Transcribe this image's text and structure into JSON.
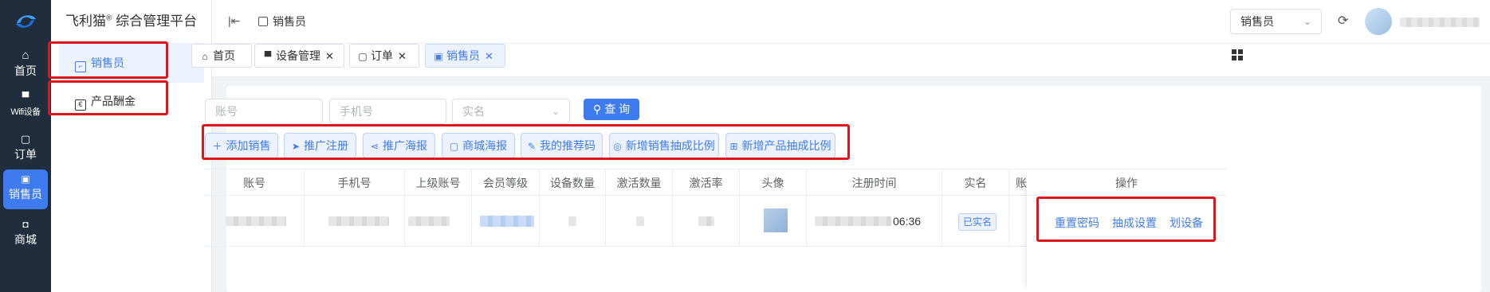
{
  "rail": {
    "items": [
      {
        "label": "首页",
        "icon": "home-icon"
      },
      {
        "label": "Wifi设备",
        "icon": "monitor-icon"
      },
      {
        "label": "订单",
        "icon": "clipboard-icon"
      },
      {
        "label": "销售员",
        "icon": "badge-icon"
      },
      {
        "label": "商城",
        "icon": "shop-icon"
      }
    ],
    "active_index": 3,
    "accent": "#3e7bf0",
    "background": "#1f2d3d"
  },
  "brand": {
    "name": "飞利猫",
    "mark": "®",
    "suffix": " 综合管理平台"
  },
  "sidebar": {
    "items": [
      {
        "label": "销售员",
        "icon": "badge-icon"
      },
      {
        "label": "产品酬金",
        "icon": "currency-icon"
      }
    ],
    "active_index": 0
  },
  "header": {
    "breadcrumb": "销售员",
    "role_select": {
      "value": "销售员"
    }
  },
  "tabs": [
    {
      "label": "首页",
      "icon": "home-icon",
      "closable": false
    },
    {
      "label": "设备管理",
      "icon": "monitor-icon",
      "closable": true
    },
    {
      "label": "订单",
      "icon": "clipboard-icon",
      "closable": true
    },
    {
      "label": "销售员",
      "icon": "badge-icon",
      "closable": true,
      "active": true
    }
  ],
  "filters": {
    "account_placeholder": "账号",
    "phone_placeholder": "手机号",
    "realname_placeholder": "实名",
    "query_label": "查 询"
  },
  "actions": [
    {
      "label": "添加销售",
      "icon": "plus-icon"
    },
    {
      "label": "推广注册",
      "icon": "send-icon"
    },
    {
      "label": "推广海报",
      "icon": "share-icon"
    },
    {
      "label": "商城海报",
      "icon": "bag-icon"
    },
    {
      "label": "我的推荐码",
      "icon": "edit-icon"
    },
    {
      "label": "新增销售抽成比例",
      "icon": "coins-icon"
    },
    {
      "label": "新增产品抽成比例",
      "icon": "bag-percent-icon"
    }
  ],
  "table": {
    "columns": [
      "账号",
      "手机号",
      "上级账号",
      "会员等级",
      "设备数量",
      "激活数量",
      "激活率",
      "头像",
      "注册时间",
      "实名",
      "账"
    ],
    "ops_header": "操作",
    "rows": [
      {
        "register_time_tail": "06:36",
        "realname_badge": "已实名"
      }
    ],
    "row_actions": [
      "重置密码",
      "抽成设置",
      "划设备"
    ]
  }
}
